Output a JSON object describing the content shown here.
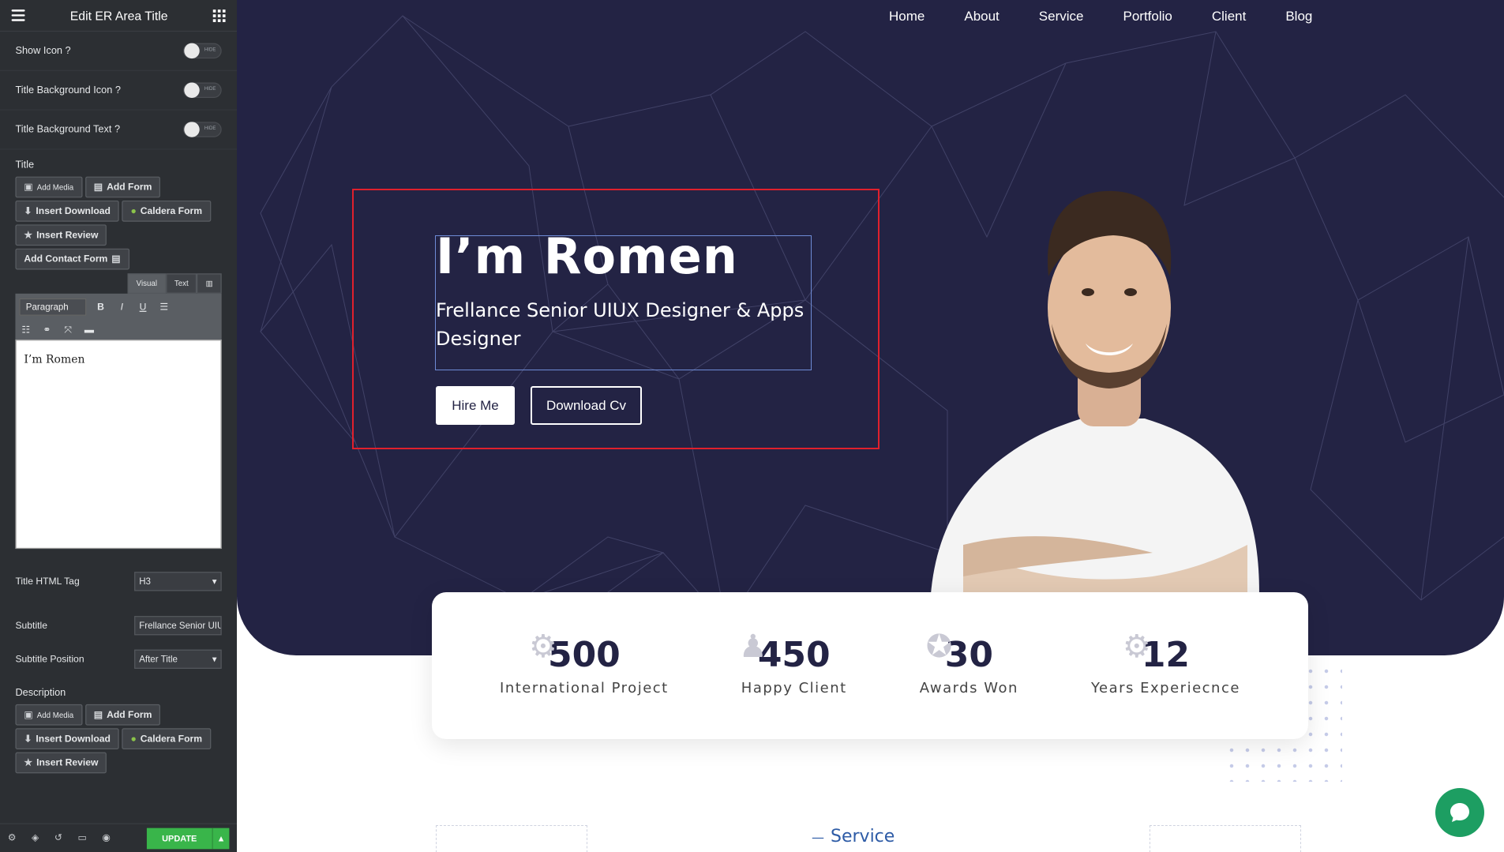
{
  "editor": {
    "header_title": "Edit ER Area Title",
    "toggles": [
      {
        "label": "Show Icon ?",
        "state": "HIDE"
      },
      {
        "label": "Title Background Icon ?",
        "state": "HIDE"
      },
      {
        "label": "Title Background Text ?",
        "state": "HIDE"
      }
    ],
    "title_section_label": "Title",
    "media_buttons": {
      "add_media": "Add Media",
      "add_form": "Add Form",
      "insert_download": "Insert Download",
      "caldera_form": "Caldera Form",
      "insert_review": "Insert Review",
      "add_contact_form": "Add Contact Form"
    },
    "editor_tabs": {
      "visual": "Visual",
      "text": "Text"
    },
    "paragraph_select": "Paragraph",
    "editor_content": "I’m Romen",
    "html_tag": {
      "label": "Title HTML Tag",
      "value": "H3"
    },
    "subtitle": {
      "label": "Subtitle",
      "value": "Frellance Senior UIUX"
    },
    "subtitle_position": {
      "label": "Subtitle Position",
      "value": "After Title"
    },
    "description_label": "Description",
    "update_label": "UPDATE"
  },
  "site": {
    "nav": [
      "Home",
      "About",
      "Service",
      "Portfolio",
      "Client",
      "Blog"
    ],
    "headline": "I’m Romen",
    "subheadline": "Frellance Senior UIUX Designer & Apps Designer",
    "hire_button": "Hire Me",
    "cv_button": "Download Cv",
    "stats": [
      {
        "value": "500",
        "label": "International Project",
        "icon": "gear-bulb-icon"
      },
      {
        "value": "450",
        "label": "Happy Client",
        "icon": "people-icon"
      },
      {
        "value": "30",
        "label": "Awards Won",
        "icon": "award-icon"
      },
      {
        "value": "12",
        "label": "Years Experiecnce",
        "icon": "gear-bulb-icon"
      }
    ],
    "service_heading": "Service"
  },
  "colors": {
    "hero_bg": "#232344",
    "selection_border": "#e0202c",
    "update_button": "#39b54a",
    "chat_button": "#1d9e62"
  }
}
